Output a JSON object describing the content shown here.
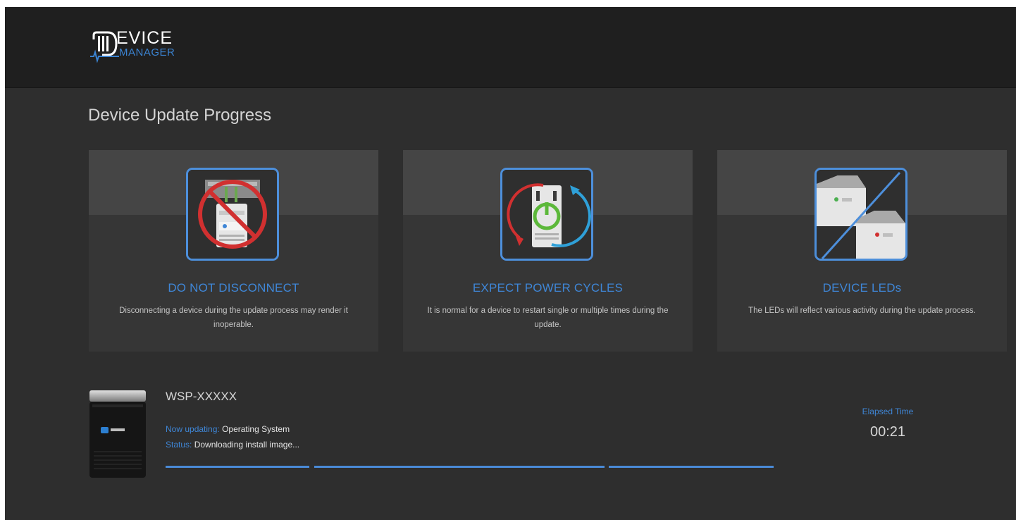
{
  "header": {
    "logo_word": "EVICE",
    "logo_sub": "MANAGER"
  },
  "page": {
    "title": "Device Update Progress"
  },
  "cards": [
    {
      "icon": "no-disconnect-icon",
      "title": "DO NOT DISCONNECT",
      "description": "Disconnecting a device during the update process may render it inoperable."
    },
    {
      "icon": "power-cycle-icon",
      "title": "EXPECT POWER CYCLES",
      "description": "It is normal for a device to restart single or multiple times during the update."
    },
    {
      "icon": "device-leds-icon",
      "title": "DEVICE LEDs",
      "description": "The LEDs will reflect various activity during the update process."
    }
  ],
  "device": {
    "name": "WSP-XXXXX",
    "updating_label": "Now updating:",
    "updating_value": "Operating System",
    "status_label": "Status:",
    "status_value": "Downloading install image..."
  },
  "elapsed": {
    "label": "Elapsed Time",
    "value": "00:21"
  },
  "progress": {
    "segments_shown": 3
  },
  "colors": {
    "accent": "#3f86d6",
    "background": "#2e2e2e",
    "header": "#1f1f1f",
    "card": "#363636",
    "warning_red": "#d13030",
    "power_green": "#5cb83a"
  }
}
